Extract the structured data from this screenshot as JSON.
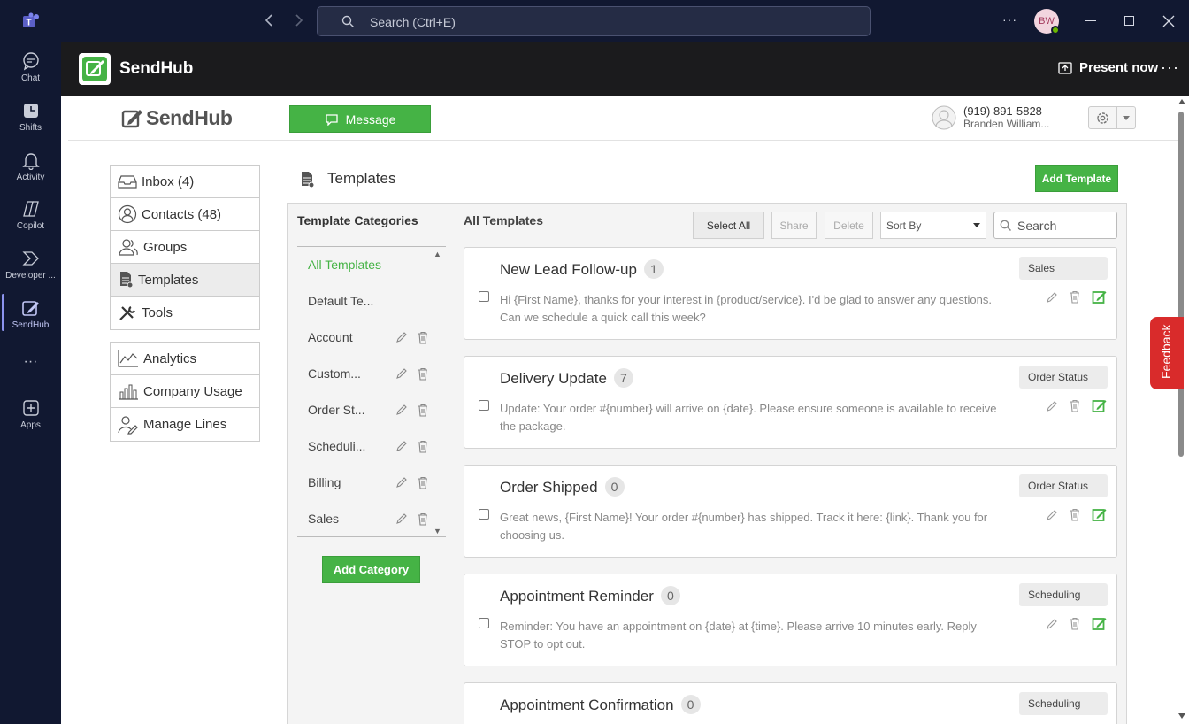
{
  "titlebar": {
    "search_placeholder": "Search (Ctrl+E)",
    "avatar_initials": "BW",
    "more_label": "···"
  },
  "rail": {
    "items": [
      {
        "label": "Chat",
        "icon": "chat-icon"
      },
      {
        "label": "Shifts",
        "icon": "shifts-icon"
      },
      {
        "label": "Activity",
        "icon": "bell-icon"
      },
      {
        "label": "Copilot",
        "icon": "copilot-icon"
      },
      {
        "label": "Developer ...",
        "icon": "developer-portal-icon"
      },
      {
        "label": "SendHub",
        "icon": "sendhub-icon",
        "active": true
      },
      {
        "label": "···",
        "icon": "more-icon"
      },
      {
        "label": "Apps",
        "icon": "apps-icon"
      }
    ]
  },
  "app_header": {
    "title": "SendHub",
    "present_now": "Present now",
    "more": "···"
  },
  "sendhub": {
    "logo_text": "SendHub",
    "message_button": "Message",
    "user_phone": "(919) 891-5828",
    "user_name": "Branden William..."
  },
  "nav": {
    "primary": [
      {
        "label": "Inbox (4)",
        "icon": "inbox-icon"
      },
      {
        "label": "Contacts (48)",
        "icon": "contacts-icon"
      },
      {
        "label": "Groups",
        "icon": "groups-icon"
      },
      {
        "label": "Templates",
        "icon": "templates-icon",
        "active": true
      },
      {
        "label": "Tools",
        "icon": "tools-icon"
      }
    ],
    "secondary": [
      {
        "label": "Analytics",
        "icon": "analytics-icon"
      },
      {
        "label": "Company Usage",
        "icon": "company-usage-icon"
      },
      {
        "label": "Manage Lines",
        "icon": "manage-lines-icon"
      }
    ]
  },
  "templates": {
    "title": "Templates",
    "add_template": "Add Template",
    "categories_title": "Template Categories",
    "categories": [
      {
        "label": "All Templates",
        "active": true,
        "editable": false
      },
      {
        "label": "Default Te...",
        "editable": false
      },
      {
        "label": "Account",
        "editable": true
      },
      {
        "label": "Custom...",
        "editable": true
      },
      {
        "label": "Order St...",
        "editable": true
      },
      {
        "label": "Scheduli...",
        "editable": true
      },
      {
        "label": "Billing",
        "editable": true
      },
      {
        "label": "Sales",
        "editable": true
      }
    ],
    "add_category": "Add Category",
    "list_title": "All Templates",
    "toolbar": {
      "select_all": "Select All",
      "share": "Share",
      "delete": "Delete",
      "sort_by": "Sort By",
      "search_placeholder": "Search"
    },
    "items": [
      {
        "title": "New Lead Follow-up",
        "count": "1",
        "category": "Sales",
        "body": "Hi {First Name}, thanks for your interest in {product/service}. I'd be glad to answer any questions. Can we schedule a quick call this week?"
      },
      {
        "title": "Delivery Update",
        "count": "7",
        "category": "Order Status",
        "body": "Update: Your order #{number} will arrive on {date}. Please ensure someone is available to receive the package."
      },
      {
        "title": "Order Shipped",
        "count": "0",
        "category": "Order Status",
        "body": "Great news, {First Name}! Your order #{number} has shipped. Track it here: {link}. Thank you for choosing us."
      },
      {
        "title": "Appointment Reminder",
        "count": "0",
        "category": "Scheduling",
        "body": "Reminder: You have an appointment on {date} at {time}. Please arrive 10 minutes early. Reply STOP to opt out."
      },
      {
        "title": "Appointment Confirmation",
        "count": "0",
        "category": "Scheduling",
        "body": ""
      }
    ]
  },
  "feedback": "Feedback",
  "colors": {
    "teams_bg": "#111831",
    "brand_green": "#45b345",
    "feedback_red": "#d92b2b"
  }
}
